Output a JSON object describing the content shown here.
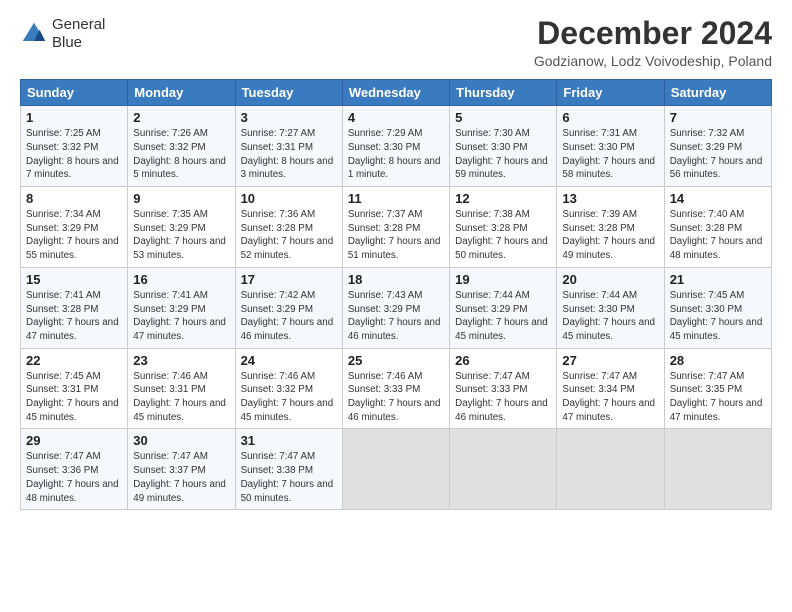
{
  "header": {
    "logo_line1": "General",
    "logo_line2": "Blue",
    "title": "December 2024",
    "subtitle": "Godzianow, Lodz Voivodeship, Poland"
  },
  "weekdays": [
    "Sunday",
    "Monday",
    "Tuesday",
    "Wednesday",
    "Thursday",
    "Friday",
    "Saturday"
  ],
  "weeks": [
    [
      {
        "day": "1",
        "sunrise": "7:25 AM",
        "sunset": "3:32 PM",
        "daylight": "8 hours and 7 minutes."
      },
      {
        "day": "2",
        "sunrise": "7:26 AM",
        "sunset": "3:32 PM",
        "daylight": "8 hours and 5 minutes."
      },
      {
        "day": "3",
        "sunrise": "7:27 AM",
        "sunset": "3:31 PM",
        "daylight": "8 hours and 3 minutes."
      },
      {
        "day": "4",
        "sunrise": "7:29 AM",
        "sunset": "3:30 PM",
        "daylight": "8 hours and 1 minute."
      },
      {
        "day": "5",
        "sunrise": "7:30 AM",
        "sunset": "3:30 PM",
        "daylight": "7 hours and 59 minutes."
      },
      {
        "day": "6",
        "sunrise": "7:31 AM",
        "sunset": "3:30 PM",
        "daylight": "7 hours and 58 minutes."
      },
      {
        "day": "7",
        "sunrise": "7:32 AM",
        "sunset": "3:29 PM",
        "daylight": "7 hours and 56 minutes."
      }
    ],
    [
      {
        "day": "8",
        "sunrise": "7:34 AM",
        "sunset": "3:29 PM",
        "daylight": "7 hours and 55 minutes."
      },
      {
        "day": "9",
        "sunrise": "7:35 AM",
        "sunset": "3:29 PM",
        "daylight": "7 hours and 53 minutes."
      },
      {
        "day": "10",
        "sunrise": "7:36 AM",
        "sunset": "3:28 PM",
        "daylight": "7 hours and 52 minutes."
      },
      {
        "day": "11",
        "sunrise": "7:37 AM",
        "sunset": "3:28 PM",
        "daylight": "7 hours and 51 minutes."
      },
      {
        "day": "12",
        "sunrise": "7:38 AM",
        "sunset": "3:28 PM",
        "daylight": "7 hours and 50 minutes."
      },
      {
        "day": "13",
        "sunrise": "7:39 AM",
        "sunset": "3:28 PM",
        "daylight": "7 hours and 49 minutes."
      },
      {
        "day": "14",
        "sunrise": "7:40 AM",
        "sunset": "3:28 PM",
        "daylight": "7 hours and 48 minutes."
      }
    ],
    [
      {
        "day": "15",
        "sunrise": "7:41 AM",
        "sunset": "3:28 PM",
        "daylight": "7 hours and 47 minutes."
      },
      {
        "day": "16",
        "sunrise": "7:41 AM",
        "sunset": "3:29 PM",
        "daylight": "7 hours and 47 minutes."
      },
      {
        "day": "17",
        "sunrise": "7:42 AM",
        "sunset": "3:29 PM",
        "daylight": "7 hours and 46 minutes."
      },
      {
        "day": "18",
        "sunrise": "7:43 AM",
        "sunset": "3:29 PM",
        "daylight": "7 hours and 46 minutes."
      },
      {
        "day": "19",
        "sunrise": "7:44 AM",
        "sunset": "3:29 PM",
        "daylight": "7 hours and 45 minutes."
      },
      {
        "day": "20",
        "sunrise": "7:44 AM",
        "sunset": "3:30 PM",
        "daylight": "7 hours and 45 minutes."
      },
      {
        "day": "21",
        "sunrise": "7:45 AM",
        "sunset": "3:30 PM",
        "daylight": "7 hours and 45 minutes."
      }
    ],
    [
      {
        "day": "22",
        "sunrise": "7:45 AM",
        "sunset": "3:31 PM",
        "daylight": "7 hours and 45 minutes."
      },
      {
        "day": "23",
        "sunrise": "7:46 AM",
        "sunset": "3:31 PM",
        "daylight": "7 hours and 45 minutes."
      },
      {
        "day": "24",
        "sunrise": "7:46 AM",
        "sunset": "3:32 PM",
        "daylight": "7 hours and 45 minutes."
      },
      {
        "day": "25",
        "sunrise": "7:46 AM",
        "sunset": "3:33 PM",
        "daylight": "7 hours and 46 minutes."
      },
      {
        "day": "26",
        "sunrise": "7:47 AM",
        "sunset": "3:33 PM",
        "daylight": "7 hours and 46 minutes."
      },
      {
        "day": "27",
        "sunrise": "7:47 AM",
        "sunset": "3:34 PM",
        "daylight": "7 hours and 47 minutes."
      },
      {
        "day": "28",
        "sunrise": "7:47 AM",
        "sunset": "3:35 PM",
        "daylight": "7 hours and 47 minutes."
      }
    ],
    [
      {
        "day": "29",
        "sunrise": "7:47 AM",
        "sunset": "3:36 PM",
        "daylight": "7 hours and 48 minutes."
      },
      {
        "day": "30",
        "sunrise": "7:47 AM",
        "sunset": "3:37 PM",
        "daylight": "7 hours and 49 minutes."
      },
      {
        "day": "31",
        "sunrise": "7:47 AM",
        "sunset": "3:38 PM",
        "daylight": "7 hours and 50 minutes."
      },
      null,
      null,
      null,
      null
    ]
  ]
}
